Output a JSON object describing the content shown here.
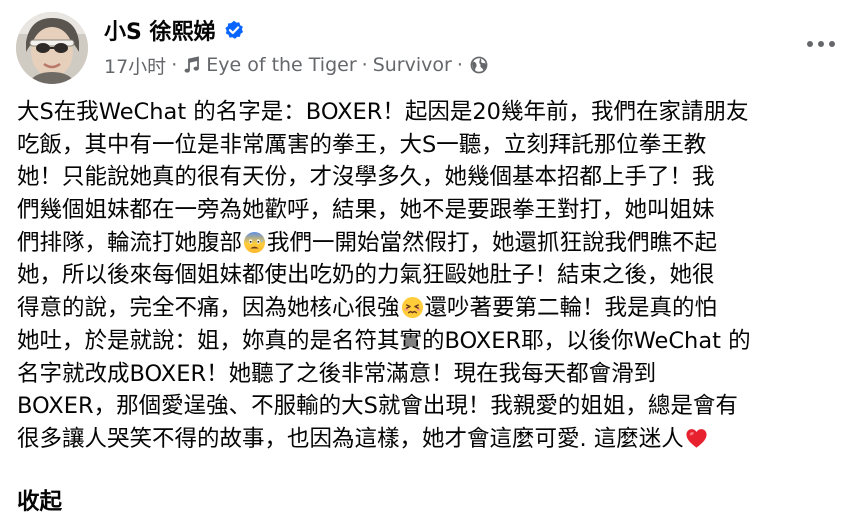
{
  "author": {
    "name": "小S 徐熙娣",
    "verified": true,
    "avatar_icon": "profile-photo"
  },
  "meta": {
    "time": "17小时",
    "separator": "·",
    "music_icon": "music-note-icon",
    "song": "Eye of the Tiger",
    "artist": "Survivor",
    "audience_icon": "globe-icon"
  },
  "post": {
    "lines": [
      "大S在我WeChat 的名字是：BOXER！起因是20幾年前，我們在家請朋友",
      "吃飯，其中有一位是非常厲害的拳王，大S一聽，立刻拜託那位拳王教",
      "她！只能說她真的很有天份，才沒學多久，她幾個基本招都上手了！我",
      "們幾個姐妹都在一旁為她歡呼，結果，她不是要跟拳王對打，她叫姐妹",
      "們排隊，輪流打她腹部",
      "我們一開始當然假打，她還抓狂說我們瞧不起",
      "她，所以後來每個姐妹都使出吃奶的力氣狂毆她肚子！結束之後，她很",
      "得意的說，完全不痛，因為她核心很強",
      "還吵著要第二輪！我是真的怕",
      "她吐，於是就說：姐，妳真的是名符其實的BOXER耶，以後你WeChat 的",
      "名字就改成BOXER！她聽了之後非常滿意！現在我每天都會滑到",
      "BOXER，那個愛逞強、不服輸的大S就會出現！我親愛的姐姐，總是會有",
      "很多讓人哭笑不得的故事，也因為這樣，她才會這麼可愛. 這麼迷人"
    ],
    "emojis": [
      "anxious-face-emoji",
      "confounded-face-emoji",
      "red-heart-emoji"
    ],
    "collapse_label": "收起"
  },
  "colors": {
    "text": "#050505",
    "secondary": "#65676b",
    "verified": "#0866ff",
    "heart": "#e8212f"
  }
}
